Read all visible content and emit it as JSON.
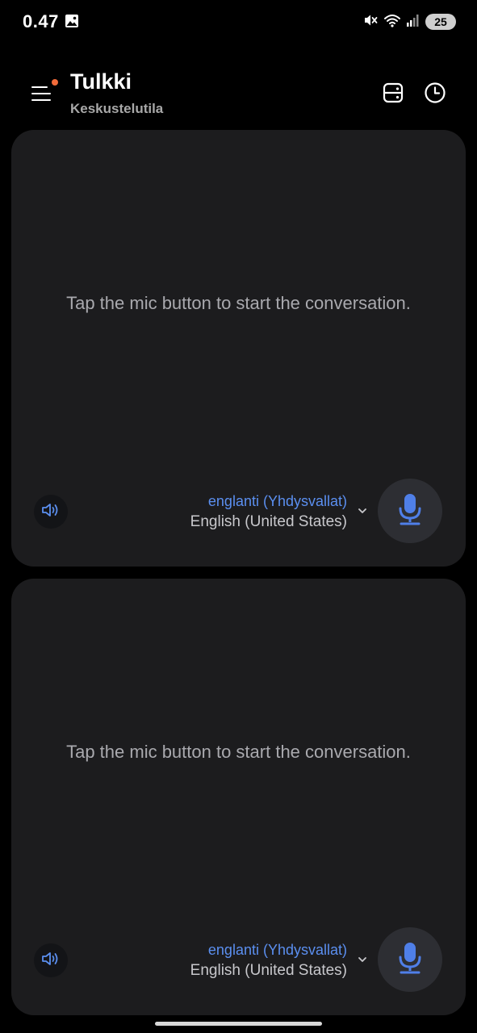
{
  "status_bar": {
    "time": "0.47",
    "battery": "25",
    "icons": [
      "gallery-icon",
      "mute-icon",
      "wifi-icon",
      "signal-icon"
    ]
  },
  "app_bar": {
    "title": "Tulkki",
    "subtitle": "Keskustelutila",
    "icons": [
      "menu-icon",
      "storage-icon",
      "history-icon"
    ],
    "notification_dot_color": "#f26b3a"
  },
  "panels": [
    {
      "prompt": "Tap the mic button to start the conversation.",
      "language_primary": "englanti (Yhdysvallat)",
      "language_secondary": "English (United States)"
    },
    {
      "prompt": "Tap the mic button to start the conversation.",
      "language_primary": "englanti (Yhdysvallat)",
      "language_secondary": "English (United States)"
    }
  ],
  "colors": {
    "accent": "#5b8ff0",
    "panel_bg": "#1c1c1e",
    "mic_button_bg": "#2d2e33"
  }
}
